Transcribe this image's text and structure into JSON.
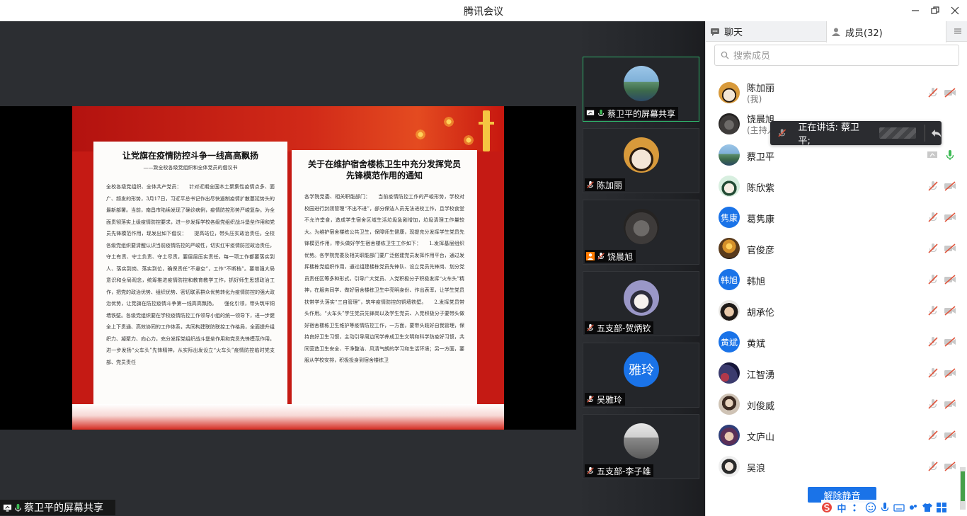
{
  "window": {
    "title": "腾讯会议"
  },
  "share": {
    "sharer_label": "蔡卫平的屏幕共享",
    "left_page": {
      "title": "让党旗在疫情防控斗争一线高高飘扬",
      "subtitle": "——致全校各级党组织和全体党员的倡议书",
      "body": "全校各级党组织、全体共产党员：　　针对近期全国本土聚集性疫情点多、面广、频发的形势，3月17日，习近平总书记作出尽快遏制疫情扩散蔓延势头的最新部署。当前，南昌市陆续发现了确诊病例，疫情防控形势严峻复杂。为全面贯彻落实上级疫情防控要求，进一步发挥学校各级党组织战斗堡垒作用和党员先锋模范作用，现发出如下倡议：　　提高站位，带头压实政治责任。全校各级党组织要清醒认识当前疫情防控的严峻性，切实扛牢疫情防控政治责任，守土有责、守土负责、守土尽责，要层层压实责任，每一项工作都要落实到人、落实到岗、落实到位，确保责任“不悬空”，工作“不断档”。要增强大局意识和全局观念，统筹推进疫情防控和教育教学工作，抓好师生思想政治工作，把党的政治优势、组织优势、密切联系群众优势转化为疫情防控的强大政治优势，让党旗在防控疫情斗争第一线高高飘扬。　　强化引领，带头筑牢铜墙铁壁。各级党组织要在学校疫情防控工作领导小组的统一领导下，进一步健全上下贯通、高效协同的工作体系，共同构建联防联控工作格局，全面提升组织力、凝聚力、向心力，充分发挥党组织战斗堡垒作用和党员先锋模范作用，进一步发扬“火车头”先锋精神，从实际出发设立“火车头”疫情防控临时党支部、党员责任"
    },
    "right_page": {
      "title": "关于在维护宿舍楼栋卫生中充分发挥党员先锋模范作用的通知",
      "body": "各学院党委、相关职能部门：　　当前疫情防控工作的严峻形势，学校对校园进行封闭管理“不出不进”，部分保洁人员无法进校工作，且学校食堂不允许堂食，造成学生宿舍区域生活垃圾急剧增加，垃圾清理工作量较大。为维护宿舍楼栋公共卫生，保障师生健康，现提充分发挥学生党员先锋模范作用，带头做好学生宿舍楼栋卫生工作如下：　　1.发挥基层组织优势。各学院党委及相关职能部门要广泛搭建党员发挥作用平台，通过发挥楼栋党组织作用，通过组建楼栋党员先锋队、设立党员先锋岗、划分党员责任区等多种形式，引导广大党员、入党积极分子积极发挥“火车头”精神，在服务同学、做好宿舍楼栋卫生中亮明身份、作出表率，让学生党员扶带学头落实“三自管理”，筑牢疫情防控的铜墙铁壁。　　2.发挥党员带头作用。“火车头”学生党员先锋岗以及学生党员、入党积极分子要带头做好宿舍楼栋卫生维护等疫情防控工作，一方面，要带头践好自我管理，保持良好卫生习惯，主动引导周边同学养成卫生文明和科学防疫好习惯，共同营造卫生安全、干净整洁、风清气朗的学习和生活环境；另一方面，要服从学校安排，积极投身到宿舍楼栋卫"
    }
  },
  "videos": [
    {
      "name": "蔡卫平的屏幕共享",
      "active": true
    },
    {
      "name": "陈加丽"
    },
    {
      "name": "饶晨旭"
    },
    {
      "name": "五支部-贺炳钦"
    },
    {
      "name": "吴雅玲",
      "avatar_text": "雅玲"
    },
    {
      "name": "五支部-李子雄"
    }
  ],
  "panel": {
    "tab_chat": "聊天",
    "tab_members": "成员(32)",
    "search_placeholder": "搜索成员",
    "members": [
      {
        "name": "陈加丽",
        "role": "(我)"
      },
      {
        "name": "饶晨旭",
        "role": "(主持人)"
      },
      {
        "name": "蔡卫平",
        "mic_on": true,
        "sharing": true
      },
      {
        "name": "陈欣紫"
      },
      {
        "name": "葛隽康",
        "avatar_text": "隽康"
      },
      {
        "name": "官俊彦"
      },
      {
        "name": "韩旭",
        "avatar_text": "韩旭"
      },
      {
        "name": "胡承伦"
      },
      {
        "name": "黄斌",
        "avatar_text": "黄斌"
      },
      {
        "name": "江智湧"
      },
      {
        "name": "刘俊威"
      },
      {
        "name": "文庐山"
      },
      {
        "name": "吴浪"
      }
    ],
    "speaking_text": "正在讲话: 蔡卫平;",
    "unmute_all": "解除静音"
  },
  "ime": {
    "label": "中"
  },
  "colors": {
    "accent": "#1a73e8",
    "active_border": "#2fb36b",
    "mic_green": "#3cba54",
    "muted_red": "#e0553d"
  }
}
